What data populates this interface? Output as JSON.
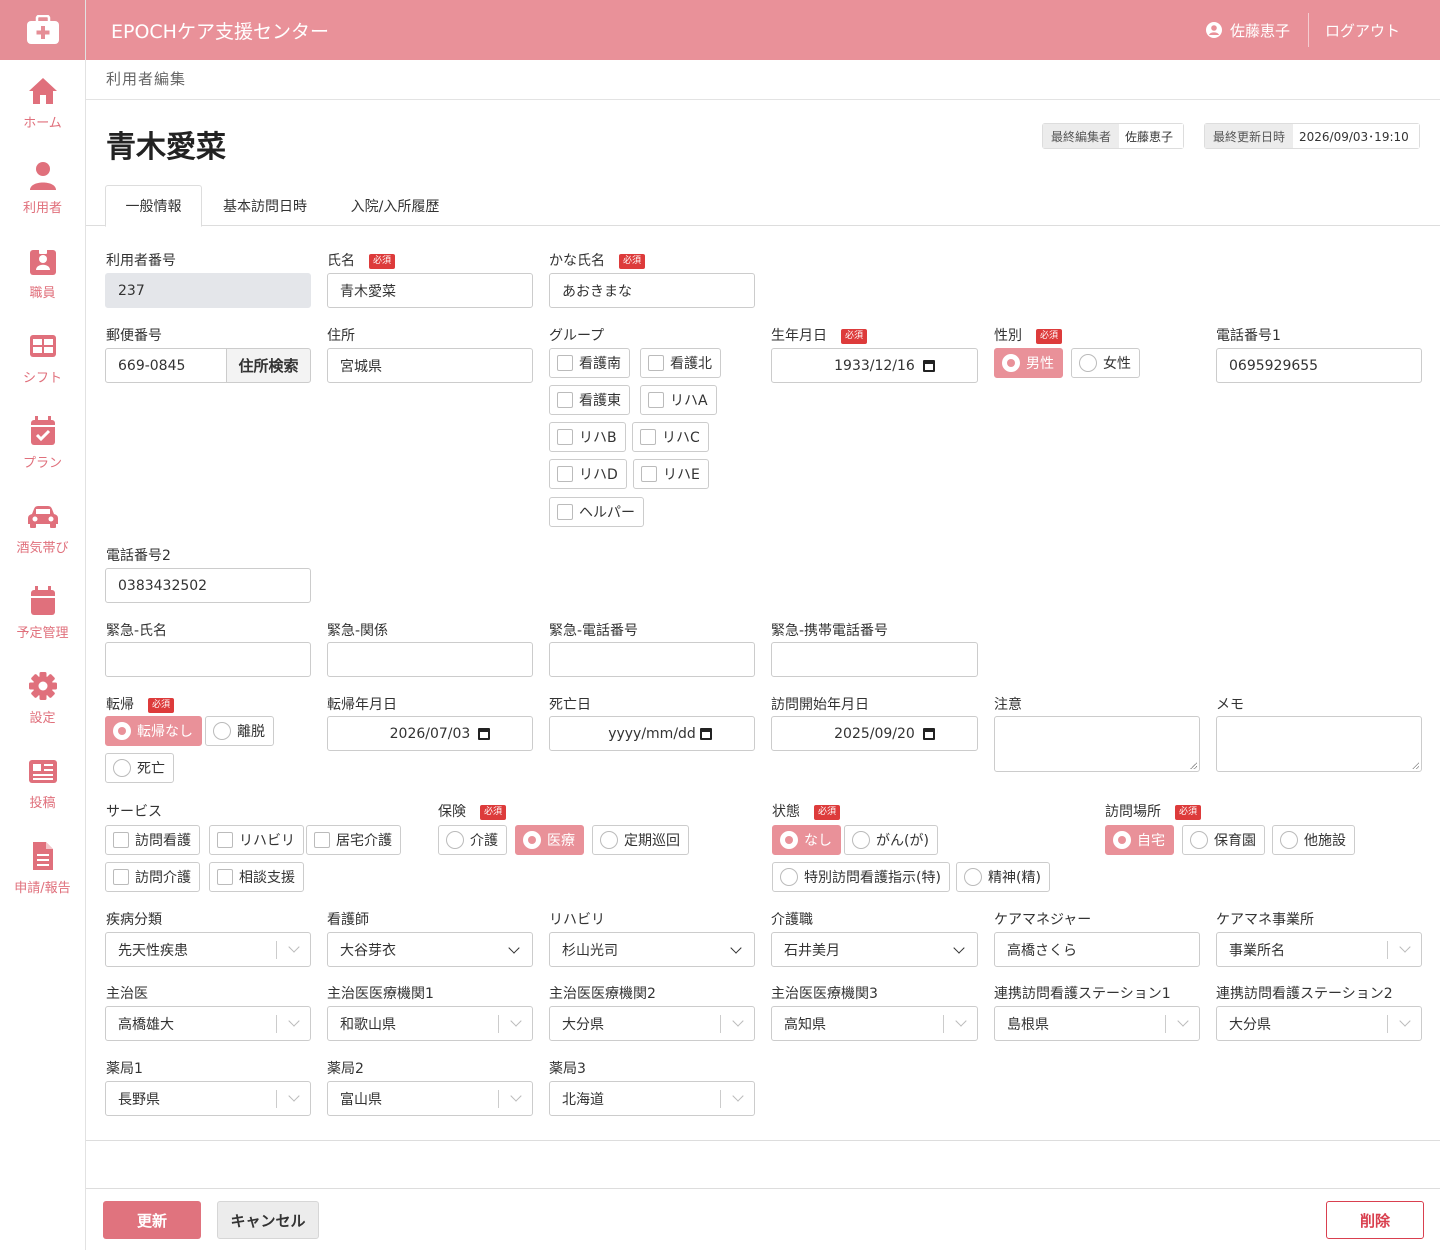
{
  "app": {
    "title": "EPOCHケア支援センター",
    "user": "佐藤恵子",
    "logout": "ログアウト"
  },
  "sidebar": {
    "items": [
      {
        "label": "ホーム",
        "icon": "home-icon"
      },
      {
        "label": "利用者",
        "icon": "person-icon"
      },
      {
        "label": "職員",
        "icon": "id-badge-icon"
      },
      {
        "label": "シフト",
        "icon": "grid-icon"
      },
      {
        "label": "プラン",
        "icon": "calendar-check-icon"
      },
      {
        "label": "酒気帯び",
        "icon": "car-icon"
      },
      {
        "label": "予定管理",
        "icon": "calendar-icon"
      },
      {
        "label": "設定",
        "icon": "gear-icon"
      },
      {
        "label": "投稿",
        "icon": "newspaper-icon"
      },
      {
        "label": "申請/報告",
        "icon": "document-icon"
      }
    ]
  },
  "breadcrumb": "利用者編集",
  "page": {
    "name": "青木愛菜",
    "last_editor_label": "最終編集者",
    "last_editor": "佐藤恵子",
    "last_updated_label": "最終更新日時",
    "last_updated": "2026/09/03･19:10"
  },
  "tabs": [
    "一般情報",
    "基本訪問日時",
    "入院/入所履歴"
  ],
  "required_badge": "必須",
  "form": {
    "user_no": {
      "label": "利用者番号",
      "value": "237"
    },
    "name": {
      "label": "氏名",
      "value": "青木愛菜"
    },
    "kana": {
      "label": "かな氏名",
      "value": "あおきまな"
    },
    "postal": {
      "label": "郵便番号",
      "value": "669-0845",
      "button": "住所検索"
    },
    "address": {
      "label": "住所",
      "value": "宮城県"
    },
    "group": {
      "label": "グループ",
      "options": [
        "看護南",
        "看護北",
        "看護東",
        "リハA",
        "リハB",
        "リハC",
        "リハD",
        "リハE",
        "ヘルパー"
      ]
    },
    "birth": {
      "label": "生年月日",
      "value": "1933/12/16"
    },
    "gender": {
      "label": "性別",
      "options": [
        "男性",
        "女性"
      ],
      "selected": "男性"
    },
    "phone1": {
      "label": "電話番号1",
      "value": "0695929655"
    },
    "phone2": {
      "label": "電話番号2",
      "value": "0383432502"
    },
    "em_name": {
      "label": "緊急-氏名",
      "value": ""
    },
    "em_rel": {
      "label": "緊急-関係",
      "value": ""
    },
    "em_phone": {
      "label": "緊急-電話番号",
      "value": ""
    },
    "em_mobile": {
      "label": "緊急-携帯電話番号",
      "value": ""
    },
    "outcome": {
      "label": "転帰",
      "options": [
        "転帰なし",
        "離脱",
        "死亡"
      ],
      "selected": "転帰なし"
    },
    "outcome_date": {
      "label": "転帰年月日",
      "value": "2026/07/03"
    },
    "death_date": {
      "label": "死亡日",
      "value": "yyyy/mm/dd"
    },
    "visit_start": {
      "label": "訪問開始年月日",
      "value": "2025/09/20"
    },
    "caution": {
      "label": "注意",
      "value": ""
    },
    "memo": {
      "label": "メモ",
      "value": ""
    },
    "service": {
      "label": "サービス",
      "options": [
        "訪問看護",
        "リハビリ",
        "居宅介護",
        "訪問介護",
        "相談支援"
      ]
    },
    "insurance": {
      "label": "保険",
      "options": [
        "介護",
        "医療",
        "定期巡回"
      ],
      "selected": "医療"
    },
    "status": {
      "label": "状態",
      "options": [
        "なし",
        "がん(が)",
        "特別訪問看護指示(特)",
        "精神(精)"
      ],
      "selected": "なし"
    },
    "place": {
      "label": "訪問場所",
      "options": [
        "自宅",
        "保育園",
        "他施設"
      ],
      "selected": "自宅"
    },
    "disease": {
      "label": "疾病分類",
      "value": "先天性疾患"
    },
    "nurse": {
      "label": "看護師",
      "value": "大谷芽衣"
    },
    "rehab": {
      "label": "リハビリ",
      "value": "杉山光司"
    },
    "caregiver": {
      "label": "介護職",
      "value": "石井美月"
    },
    "care_manager": {
      "label": "ケアマネジャー",
      "value": "高橋さくら"
    },
    "care_office": {
      "label": "ケアマネ事業所",
      "value": "事業所名"
    },
    "doctor": {
      "label": "主治医",
      "value": "高橋雄大"
    },
    "hosp1": {
      "label": "主治医医療機関1",
      "value": "和歌山県"
    },
    "hosp2": {
      "label": "主治医医療機関2",
      "value": "大分県"
    },
    "hosp3": {
      "label": "主治医医療機関3",
      "value": "高知県"
    },
    "station1": {
      "label": "連携訪問看護ステーション1",
      "value": "島根県"
    },
    "station2": {
      "label": "連携訪問看護ステーション2",
      "value": "大分県"
    },
    "pharm1": {
      "label": "薬局1",
      "value": "長野県"
    },
    "pharm2": {
      "label": "薬局2",
      "value": "富山県"
    },
    "pharm3": {
      "label": "薬局3",
      "value": "北海道"
    }
  },
  "buttons": {
    "update": "更新",
    "cancel": "キャンセル",
    "delete": "削除"
  },
  "colors": {
    "accent": "#e99199",
    "required": "#dd3b3b",
    "delete": "#d9404f"
  }
}
